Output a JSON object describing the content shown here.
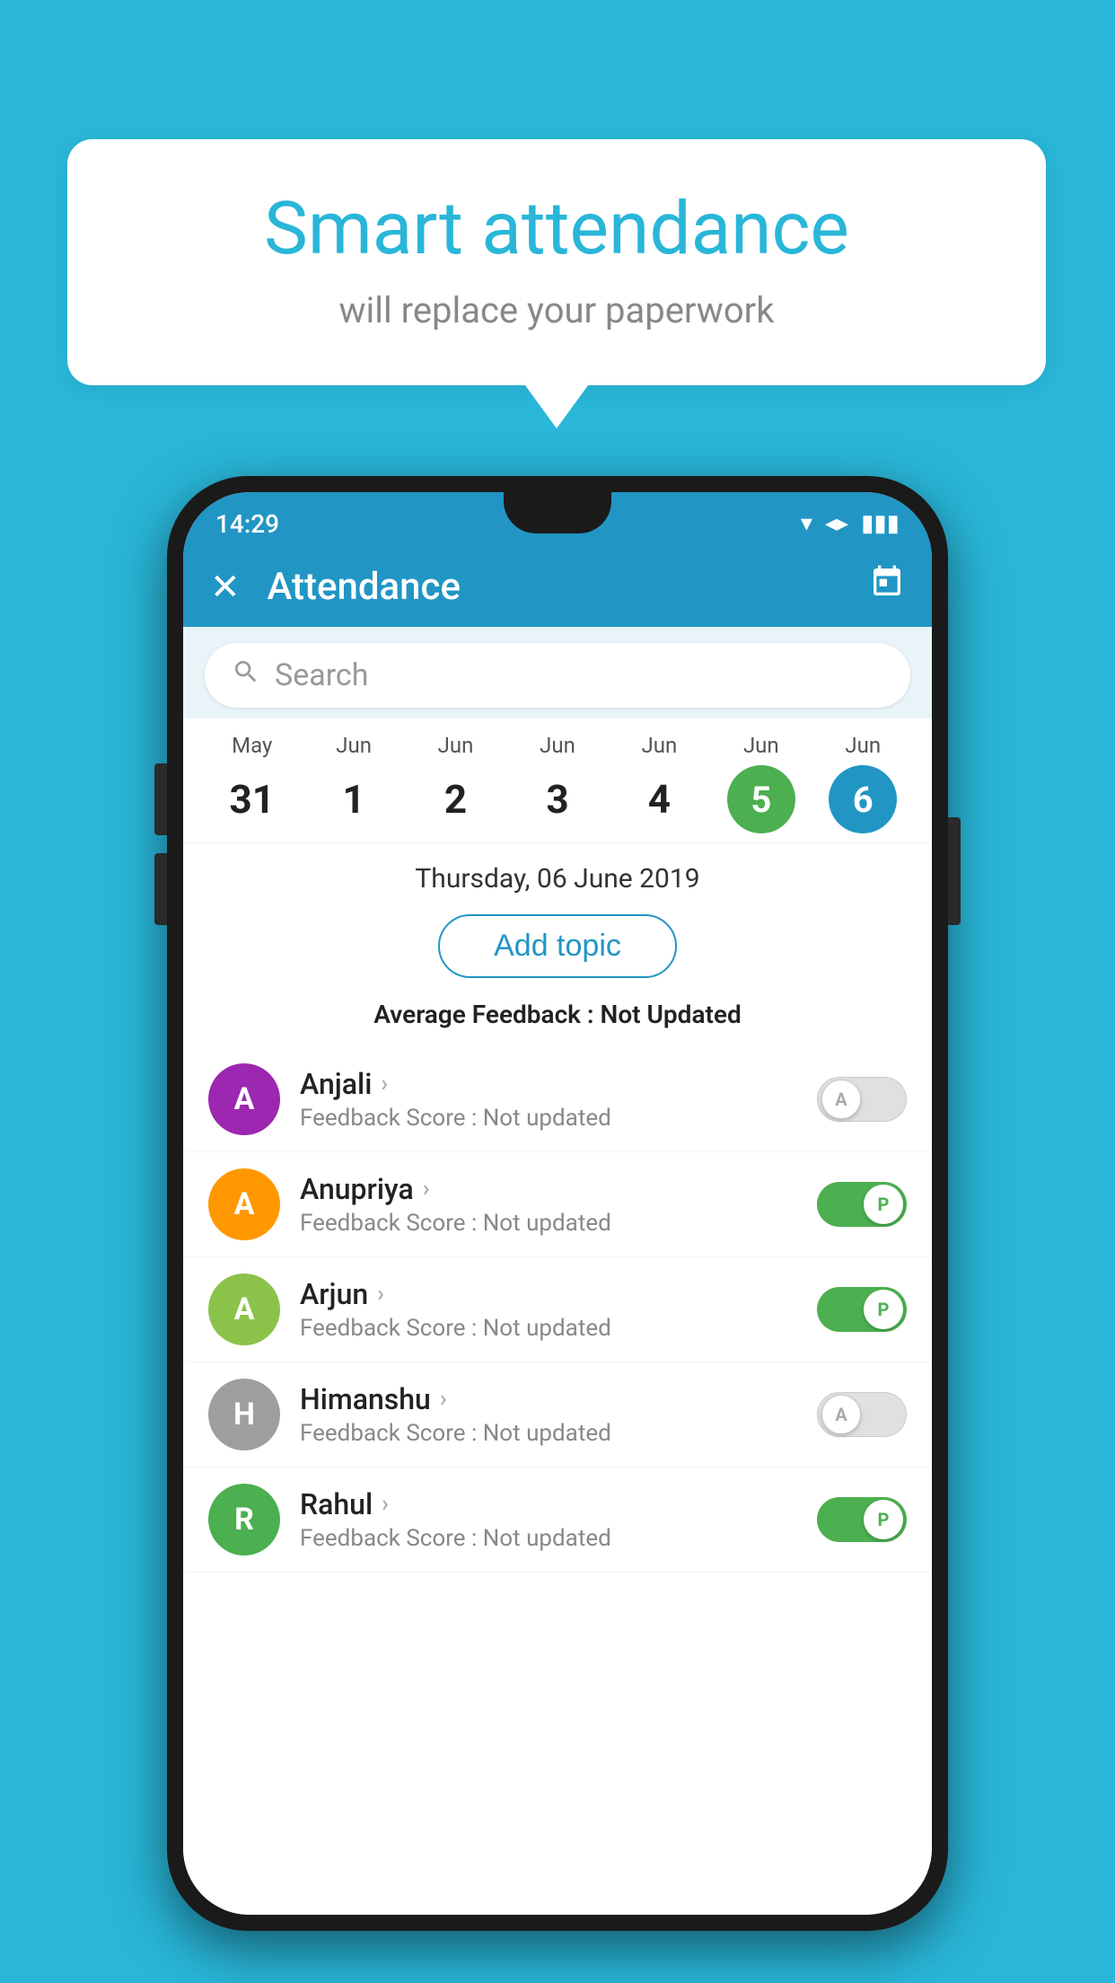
{
  "background_color": "#29b6d8",
  "bubble": {
    "title": "Smart attendance",
    "subtitle": "will replace your paperwork"
  },
  "status_bar": {
    "time": "14:29",
    "wifi": "▼",
    "signal": "▲",
    "battery": "▊"
  },
  "header": {
    "title": "Attendance",
    "close_label": "×",
    "calendar_icon": "calendar"
  },
  "search": {
    "placeholder": "Search"
  },
  "calendar": {
    "days": [
      {
        "month": "May",
        "date": "31",
        "state": "normal"
      },
      {
        "month": "Jun",
        "date": "1",
        "state": "normal"
      },
      {
        "month": "Jun",
        "date": "2",
        "state": "normal"
      },
      {
        "month": "Jun",
        "date": "3",
        "state": "normal"
      },
      {
        "month": "Jun",
        "date": "4",
        "state": "normal"
      },
      {
        "month": "Jun",
        "date": "5",
        "state": "today"
      },
      {
        "month": "Jun",
        "date": "6",
        "state": "selected"
      }
    ]
  },
  "selected_date_label": "Thursday, 06 June 2019",
  "add_topic_label": "Add topic",
  "avg_feedback": {
    "label": "Average Feedback : ",
    "value": "Not Updated"
  },
  "students": [
    {
      "name": "Anjali",
      "avatar_letter": "A",
      "avatar_color": "#9c27b0",
      "feedback": "Feedback Score : Not updated",
      "attendance": "absent"
    },
    {
      "name": "Anupriya",
      "avatar_letter": "A",
      "avatar_color": "#ff9800",
      "feedback": "Feedback Score : Not updated",
      "attendance": "present"
    },
    {
      "name": "Arjun",
      "avatar_letter": "A",
      "avatar_color": "#8bc34a",
      "feedback": "Feedback Score : Not updated",
      "attendance": "present"
    },
    {
      "name": "Himanshu",
      "avatar_letter": "H",
      "avatar_color": "#9e9e9e",
      "feedback": "Feedback Score : Not updated",
      "attendance": "absent"
    },
    {
      "name": "Rahul",
      "avatar_letter": "R",
      "avatar_color": "#4caf50",
      "feedback": "Feedback Score : Not updated",
      "attendance": "present"
    }
  ],
  "icons": {
    "search": "🔍",
    "close": "✕",
    "calendar": "📅",
    "chevron_right": "›"
  }
}
